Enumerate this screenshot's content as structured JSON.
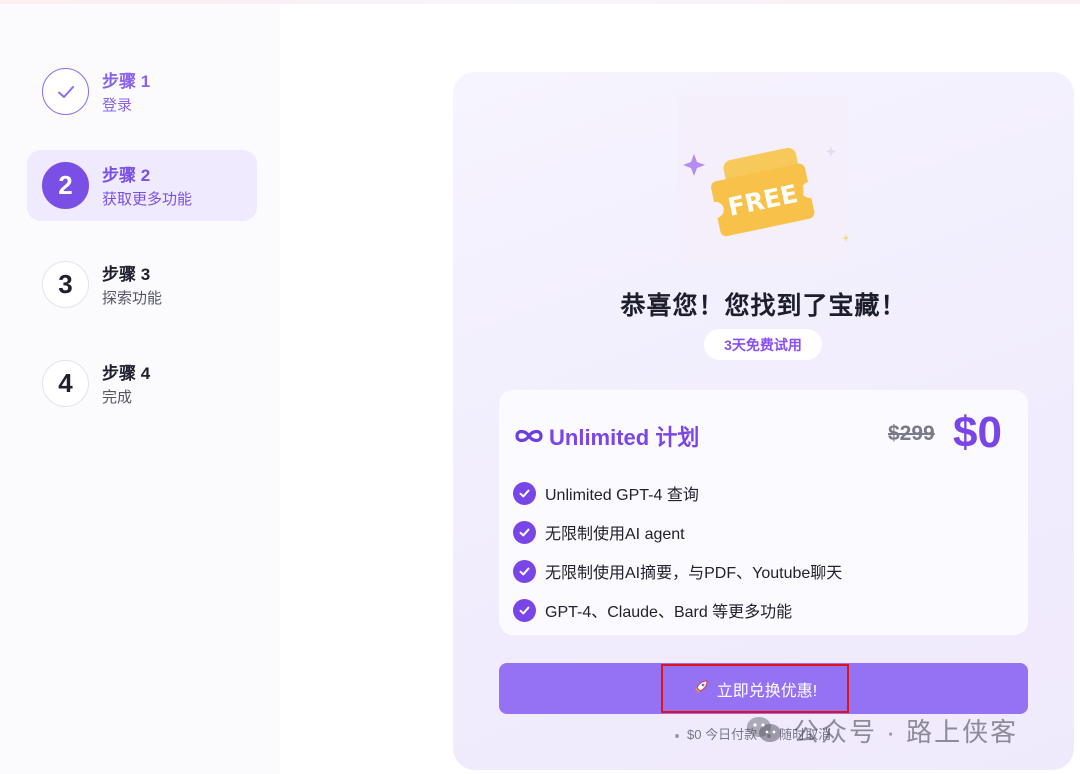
{
  "steps": [
    {
      "title": "步骤 1",
      "subtitle": "登录",
      "state": "done",
      "number": "1"
    },
    {
      "title": "步骤 2",
      "subtitle": "获取更多功能",
      "state": "active",
      "number": "2"
    },
    {
      "title": "步骤 3",
      "subtitle": "探索功能",
      "state": "pending",
      "number": "3"
    },
    {
      "title": "步骤 4",
      "subtitle": "完成",
      "state": "pending",
      "number": "4"
    }
  ],
  "card": {
    "hero_badge_text": "FREE",
    "headline": "恭喜您！您找到了宝藏！",
    "trial_pill": "3天免费试用",
    "plan": {
      "name": "Unlimited 计划",
      "price_old": "$299",
      "price_new": "$0",
      "features": [
        "Unlimited GPT-4 查询",
        "无限制使用AI agent",
        "无限制使用AI摘要，与PDF、Youtube聊天",
        "GPT-4、Claude、Bard 等更多功能"
      ]
    },
    "cta_label": "立即兑换优惠!",
    "footnote_prefix": "$0 今日付款",
    "footnote_suffix": "随时取消"
  },
  "watermark": {
    "text": "公众号 · 路上侠客"
  },
  "colors": {
    "accent": "#7a45e6",
    "cta": "#9571f3",
    "highlight_border": "#e0131b"
  }
}
